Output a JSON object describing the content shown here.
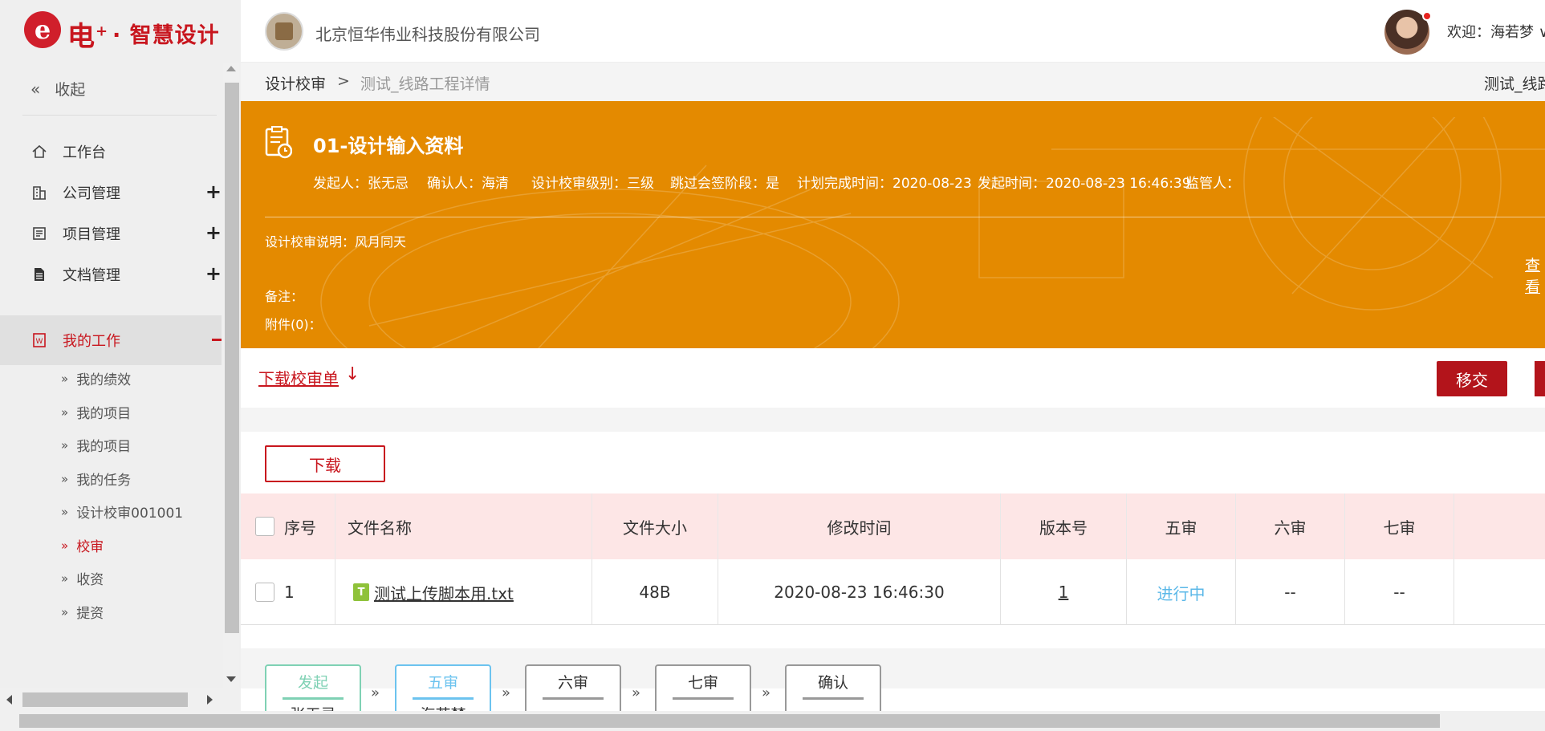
{
  "logo": {
    "mark": "e",
    "brand": "电",
    "plus": "+",
    "sub": "· 智慧设计"
  },
  "header": {
    "company": "北京恒华伟业科技股份有限公司",
    "welcome": "欢迎：海若梦 ∨"
  },
  "sidebar": {
    "collapse_label": "收起",
    "items": [
      {
        "label": "工作台",
        "icon": "home-icon"
      },
      {
        "label": "公司管理",
        "icon": "building-icon",
        "expand": "+"
      },
      {
        "label": "项目管理",
        "icon": "project-icon",
        "expand": "+"
      },
      {
        "label": "文档管理",
        "icon": "document-icon",
        "expand": "+"
      },
      {
        "label": "我的工作",
        "icon": "word-doc-icon",
        "expand": "−"
      }
    ],
    "sub_items": [
      {
        "label": "我的绩效"
      },
      {
        "label": "我的项目"
      },
      {
        "label": "我的项目"
      },
      {
        "label": "我的任务"
      },
      {
        "label": "设计校审001001"
      },
      {
        "label": "校审"
      },
      {
        "label": "收资"
      },
      {
        "label": "提资"
      }
    ],
    "active_sub": "校审"
  },
  "breadcrumb": {
    "root": "设计校审",
    "separator": ">",
    "current": "测试_线路工程详情",
    "right_title": "测试_线路"
  },
  "banner": {
    "title": "01-设计输入资料",
    "meta": [
      "发起人：张无忌",
      "确认人：海清",
      "设计校审级别：三级",
      "跳过会签阶段：是",
      "计划完成时间：2020-08-23",
      "发起时间：2020-08-23 16:46:39",
      "监管人："
    ],
    "description": "设计校审说明：风月同天",
    "note": "备注：",
    "attachments": "附件(0)：",
    "view_link": "查看"
  },
  "actions": {
    "download_sheet": "下载校审单",
    "download_arrow": "↓",
    "transfer": "移交"
  },
  "table": {
    "download_button": "下载",
    "headers": {
      "index": "序号",
      "name": "文件名称",
      "size": "文件大小",
      "modified": "修改时间",
      "version": "版本号",
      "r5": "五审",
      "r6": "六审",
      "r7": "七审"
    },
    "rows": [
      {
        "index": "1",
        "file_icon": "T",
        "name": "测试上传脚本用.txt",
        "size": "48B",
        "modified": "2020-08-23 16:46:30",
        "version": "1",
        "r5": "进行中",
        "r6": "--",
        "r7": "--"
      }
    ]
  },
  "flow": {
    "steps": [
      {
        "title": "发起",
        "person": "张无忌",
        "state": "done"
      },
      {
        "title": "五审",
        "person": "海若梦",
        "state": "current"
      },
      {
        "title": "六审",
        "person": "",
        "state": "todo"
      },
      {
        "title": "七审",
        "person": "",
        "state": "todo"
      },
      {
        "title": "确认",
        "person": "",
        "state": "todo"
      }
    ],
    "arrow": "»"
  },
  "colors": {
    "brand_red": "#c8161e",
    "banner_orange": "#e48a00",
    "table_header_bg": "#fde6e6",
    "status_blue": "#5bb8e8",
    "step_done": "#7fd1b4",
    "step_current": "#6cc3ef"
  }
}
